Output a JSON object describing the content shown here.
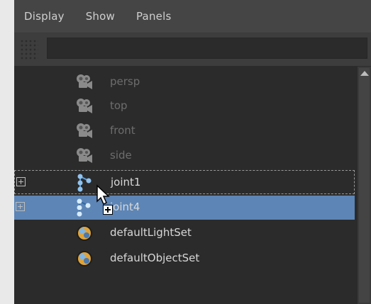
{
  "menubar": {
    "items": [
      "Display",
      "Show",
      "Panels"
    ]
  },
  "filter": {
    "value": "",
    "placeholder": ""
  },
  "outliner": {
    "rows": [
      {
        "label": "persp",
        "icon": "camera-icon",
        "dim": true
      },
      {
        "label": "top",
        "icon": "camera-icon",
        "dim": true
      },
      {
        "label": "front",
        "icon": "camera-icon",
        "dim": true
      },
      {
        "label": "side",
        "icon": "camera-icon",
        "dim": true
      },
      {
        "label": "joint1",
        "icon": "joint-icon",
        "expandable": true,
        "drop_target": true
      },
      {
        "label": "joint4",
        "icon": "joint-icon",
        "expandable": true,
        "selected": true
      },
      {
        "label": "defaultLightSet",
        "icon": "set-icon"
      },
      {
        "label": "defaultObjectSet",
        "icon": "set-icon"
      }
    ]
  },
  "colors": {
    "selection": "#5d85b5",
    "background": "#2b2b2b",
    "menubar": "#454545"
  }
}
